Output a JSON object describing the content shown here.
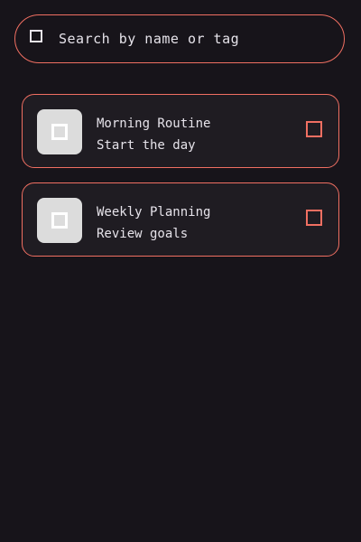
{
  "search": {
    "placeholder": "Search by name or tag",
    "icon": "search-icon"
  },
  "cards": [
    {
      "title": "Morning Routine",
      "subtitle": "Start the day",
      "thumb_icon": "image-placeholder-icon",
      "action_icon": "checkbox-icon"
    },
    {
      "title": "Weekly Planning",
      "subtitle": "Review goals",
      "thumb_icon": "image-placeholder-icon",
      "action_icon": "checkbox-icon"
    }
  ],
  "colors": {
    "background": "#17141a",
    "card": "#1f1c22",
    "accent": "#f06f62",
    "text": "#e6e3ea",
    "thumb": "#dcdcdc"
  }
}
